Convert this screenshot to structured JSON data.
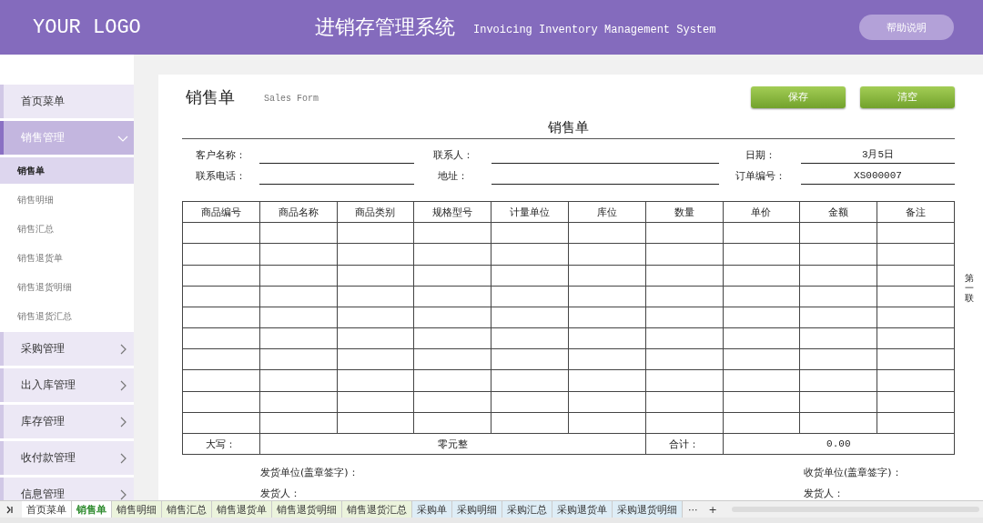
{
  "header": {
    "logo": "YOUR LOGO",
    "title": "进销存管理系统",
    "subtitle": "Invoicing Inventory Management System",
    "help_button": "帮助说明"
  },
  "sidebar": {
    "items": [
      {
        "label": "首页菜单",
        "kind": "link"
      },
      {
        "label": "销售管理",
        "kind": "group",
        "expanded": true,
        "children": [
          {
            "label": "销售单",
            "selected": true
          },
          {
            "label": "销售明细",
            "selected": false
          },
          {
            "label": "销售汇总",
            "selected": false
          },
          {
            "label": "销售退货单",
            "selected": false
          },
          {
            "label": "销售退货明细",
            "selected": false
          },
          {
            "label": "销售退货汇总",
            "selected": false
          }
        ]
      },
      {
        "label": "采购管理",
        "kind": "group",
        "expanded": false
      },
      {
        "label": "出入库管理",
        "kind": "group",
        "expanded": false
      },
      {
        "label": "库存管理",
        "kind": "group",
        "expanded": false
      },
      {
        "label": "收付款管理",
        "kind": "group",
        "expanded": false
      },
      {
        "label": "信息管理",
        "kind": "group",
        "expanded": false
      }
    ]
  },
  "page": {
    "heading": "销售单",
    "heading_en": "Sales Form",
    "buttons": [
      "保存",
      "清空"
    ],
    "side_note": "第一联"
  },
  "form": {
    "title": "销售单",
    "fields": [
      {
        "label": "客户名称："
      },
      {
        "label": "联系人："
      },
      {
        "label": "日期：",
        "value": "3月5日"
      },
      {
        "label": "联系电话："
      },
      {
        "label": "地址："
      },
      {
        "label": "订单编号：",
        "value": "XS000007"
      }
    ],
    "table": {
      "columns": [
        "商品编号",
        "商品名称",
        "商品类别",
        "规格型号",
        "计量单位",
        "库位",
        "数量",
        "单价",
        "金额",
        "备注"
      ]
    },
    "totals": {
      "words_label": "大写：",
      "words": "零元整",
      "total_label": "合计：",
      "total": "0.00"
    },
    "signatures": {
      "left": [
        "发货单位(盖章签字)：",
        "发货人："
      ],
      "right": [
        "收货单位(盖章签字)：",
        "发货人："
      ]
    }
  },
  "sheet_tabs": [
    {
      "label": "首页菜单",
      "selected": false,
      "color": "#ffffff"
    },
    {
      "label": "销售单",
      "selected": true,
      "color": "#ffffff"
    },
    {
      "label": "销售明细",
      "selected": false,
      "color": "#ebf3dc"
    },
    {
      "label": "销售汇总",
      "selected": false,
      "color": "#ebf3dc"
    },
    {
      "label": "销售退货单",
      "selected": false,
      "color": "#ebf3dc"
    },
    {
      "label": "销售退货明细",
      "selected": false,
      "color": "#ebf3dc"
    },
    {
      "label": "销售退货汇总",
      "selected": false,
      "color": "#ebf3dc"
    },
    {
      "label": "采购单",
      "selected": false,
      "color": "#deedf6"
    },
    {
      "label": "采购明细",
      "selected": false,
      "color": "#deedf6"
    },
    {
      "label": "采购汇总",
      "selected": false,
      "color": "#deedf6"
    },
    {
      "label": "采购退货单",
      "selected": false,
      "color": "#deedf6"
    },
    {
      "label": "采购退货明细",
      "selected": false,
      "color": "#deedf6"
    }
  ],
  "sheet_controls": [
    "···",
    "+"
  ]
}
